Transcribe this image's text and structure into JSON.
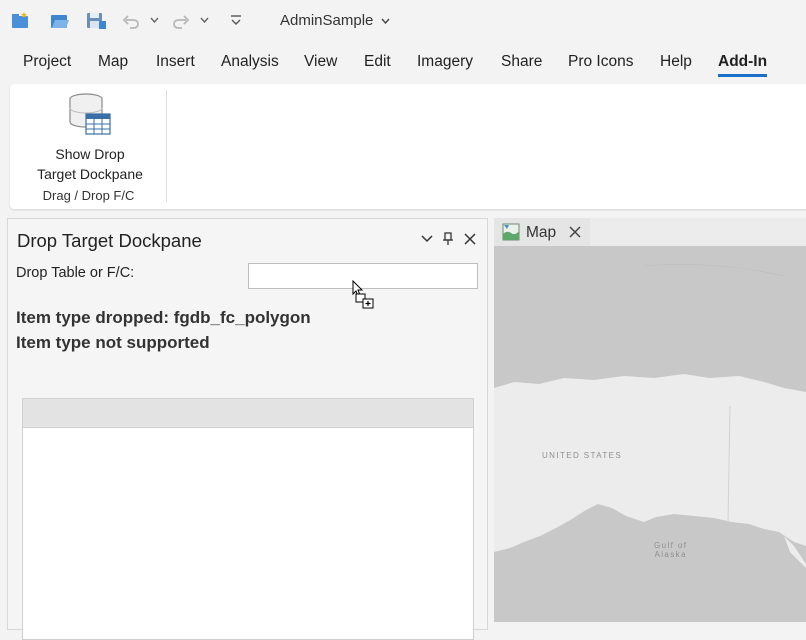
{
  "window": {
    "title": "AdminSample"
  },
  "quick_access": {
    "icons": [
      "new-project-icon",
      "open-project-icon",
      "save-project-icon",
      "undo-icon",
      "redo-icon",
      "customize-icon"
    ]
  },
  "menu": {
    "items": [
      {
        "label": "Project"
      },
      {
        "label": "Map"
      },
      {
        "label": "Insert"
      },
      {
        "label": "Analysis"
      },
      {
        "label": "View"
      },
      {
        "label": "Edit"
      },
      {
        "label": "Imagery"
      },
      {
        "label": "Share"
      },
      {
        "label": "Pro Icons"
      },
      {
        "label": "Help"
      },
      {
        "label": "Add-In",
        "active": true
      }
    ]
  },
  "ribbon": {
    "button_line1": "Show Drop",
    "button_line2": "Target Dockpane",
    "group_label": "Drag / Drop F/C"
  },
  "dockpane": {
    "title": "Drop Target Dockpane",
    "drop_label": "Drop Table or F/C:",
    "drop_value": "",
    "status_dropped": "Item type dropped: fgdb_fc_polygon",
    "status_support": "Item type not supported"
  },
  "map_view": {
    "tab_label": "Map",
    "labels": {
      "country": "UNITED STATES",
      "gulf_line1": "Gulf of",
      "gulf_line2": "Alaska"
    }
  },
  "colors": {
    "accent": "#1a6fc9",
    "ocean": "#c8c8c8",
    "land": "#ececec"
  }
}
